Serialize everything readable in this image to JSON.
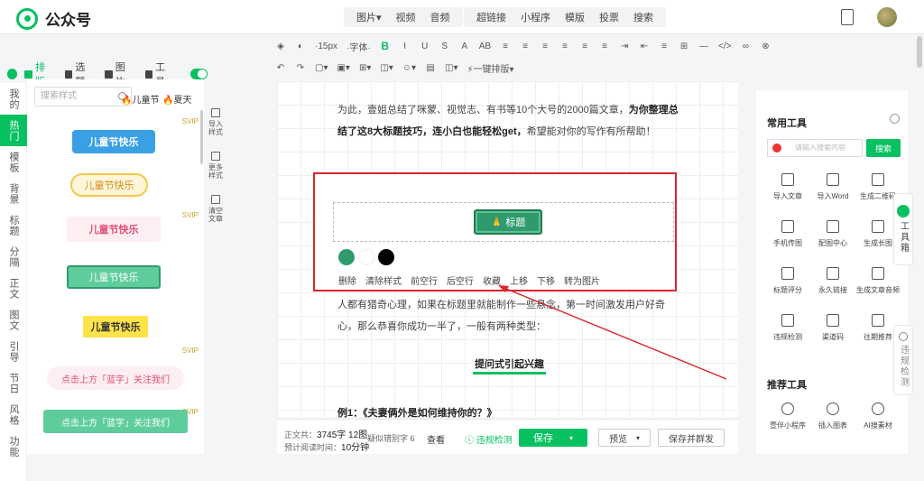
{
  "app": {
    "name": "公众号"
  },
  "insert_menu": {
    "group1": [
      "图片▾",
      "视频",
      "音频"
    ],
    "group2": [
      "超链接",
      "小程序",
      "模版",
      "投票",
      "搜索"
    ]
  },
  "toolbar": {
    "row1": [
      "◈",
      "◐",
      "·15px",
      "·字体·",
      "B",
      "I",
      "U",
      "S",
      "A",
      "AB",
      "≡",
      "≡",
      "≡",
      "≡",
      "≡",
      "≡",
      "⇥",
      "⇤",
      "≡",
      "⊞",
      "—",
      "</>",
      "∞",
      "⊗"
    ],
    "row2": [
      "↶",
      "↷",
      "▢▾",
      "▣▾",
      "⊞▾",
      "◫▾",
      "☺▾",
      "▤",
      "◫▾",
      "⚡一键排版▾"
    ]
  },
  "left_nav": [
    "我的",
    "热门",
    "模板",
    "背景",
    "标题",
    "分隔",
    "正文",
    "图文",
    "引导",
    "节日",
    "风格",
    "功能"
  ],
  "panel_tabs": [
    "排版",
    "选题",
    "图片",
    "工具"
  ],
  "style_panel": {
    "search_placeholder": "搜索样式",
    "tags": [
      "儿童节",
      "夏天"
    ],
    "samples": [
      "儿童节快乐",
      "儿童节快乐",
      "儿童节快乐",
      "儿童节快乐",
      "儿童节快乐",
      "点击上方「蓝字」关注我们",
      "点击上方「蓝字」关注我们"
    ],
    "vip": "SVIP"
  },
  "side_actions": [
    "导入样式",
    "更多样式",
    "清空文章"
  ],
  "editor": {
    "para1_a": "为此，壹姐总结了咪蒙、视觉志、有书等10个大号的2000篇文章，",
    "para1_b": "为你整理总结了这8大标题技巧，连小白也能轻松get，",
    "para1_c": "希望能对你的写作有所帮助！",
    "title_chip": "🙏 标题",
    "actions": [
      "删除",
      "清除样式",
      "前空行",
      "后空行",
      "收藏",
      "上移",
      "下移",
      "转为图片"
    ],
    "para2": "人都有猎奇心理，如果在标题里就能制作一些悬念，第一时间激发用户好奇心，那么恭喜你成功一半了，一般有两种类型：",
    "section_title": "提问式引起兴趣",
    "example": "例1：《夫妻俩外是如何维持你的？》"
  },
  "colors": {
    "accent": "#07c160",
    "swatch1": "#2f9b6d",
    "swatch2": "#ffffff",
    "swatch3": "#000000",
    "red": "#d9252c"
  },
  "footer": {
    "word_count_label": "正文共：",
    "word_count": "3745字 12图",
    "read_time_label": "预计阅读时间：",
    "read_time": "10分钟",
    "tips": "疑似错别字 6",
    "check": "查看",
    "audit": "违规检测",
    "save": "保存",
    "preview": "预览",
    "publish": "保存并群发"
  },
  "tools": {
    "common_title": "常用工具",
    "search_placeholder": "请输入搜索内容",
    "search_btn": "搜索",
    "items": [
      "导入文章",
      "导入Word",
      "生成二维码",
      "手机传图",
      "配图中心",
      "生成长图",
      "标题评分",
      "永久链接",
      "生成文章音频",
      "违规检测",
      "渠道码",
      "往期推荐"
    ],
    "recommend_title": "推荐工具",
    "rec_items": [
      "壹伴小程序",
      "插入图表",
      "AI搜素材"
    ]
  },
  "float_tabs": [
    "工具箱",
    "违规检测"
  ]
}
